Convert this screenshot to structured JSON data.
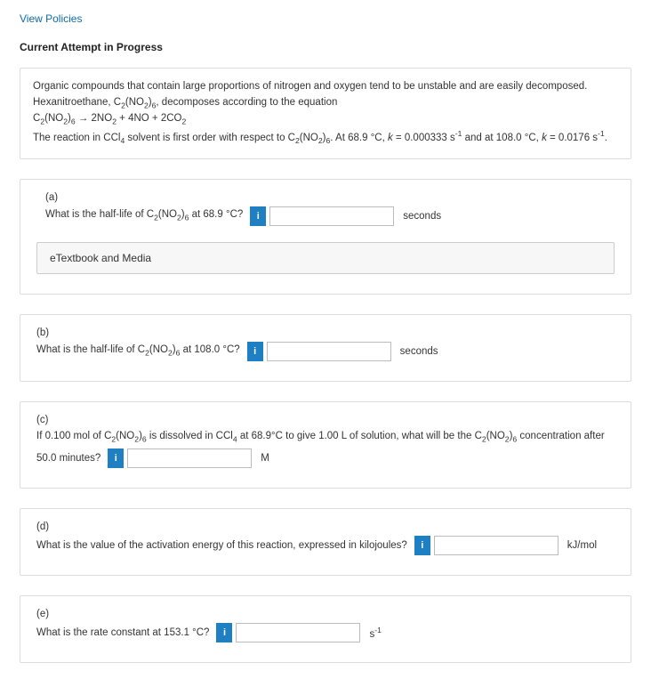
{
  "links": {
    "view_policies": "View Policies"
  },
  "heading": "Current Attempt in Progress",
  "intro": {
    "l1": "Organic compounds that contain large proportions of nitrogen and oxygen tend to be unstable and are easily decomposed.",
    "l2a": "Hexanitroethane, C",
    "l2b": "(NO",
    "l2c": ")",
    "l2d": ", decomposes according to the equation",
    "l3a": "C",
    "l3b": "(NO",
    "l3c": ")",
    "l3d": " → 2NO",
    "l3e": " + 4NO + 2CO",
    "l4a": "The reaction in CCl",
    "l4b": " solvent is first order with respect to C",
    "l4c": "(NO",
    "l4d": ")",
    "l4e": ". At 68.9 °C, ",
    "l4f": "k",
    "l4g": " = 0.000333 s",
    "l4h": " and at 108.0 °C, ",
    "l4i": "k",
    "l4j": " = 0.0176 s",
    "l4k": "."
  },
  "subs": {
    "two": "2",
    "four": "4",
    "six": "6",
    "neg1": "-1"
  },
  "info_char": "i",
  "parts": {
    "a": {
      "label": "(a)",
      "q1a": "What is the half-life of C",
      "q1b": "(NO",
      "q1c": ")",
      "q1d": " at 68.9 °C?",
      "unit": "seconds",
      "etextbook": "eTextbook and Media"
    },
    "b": {
      "label": "(b)",
      "q1a": "What is the half-life of C",
      "q1b": "(NO",
      "q1c": ")",
      "q1d": " at 108.0 °C?",
      "unit": "seconds"
    },
    "c": {
      "label": "(c)",
      "q1a": "If 0.100 mol of C",
      "q1b": "(NO",
      "q1c": ")",
      "q1d": " is dissolved in CCl",
      "q1e": " at 68.9°C to give 1.00 L of solution, what will be the C",
      "q1f": "(NO",
      "q1g": ")",
      "q1h": " concentration after",
      "q2": "50.0 minutes?",
      "unit": "M"
    },
    "d": {
      "label": "(d)",
      "q": "What is the value of the activation energy of this reaction, expressed in kilojoules?",
      "unit": "kJ/mol"
    },
    "e": {
      "label": "(e)",
      "q": "What is the rate constant at 153.1 °C?",
      "unit_a": "s",
      "unit_b": "-1"
    }
  }
}
